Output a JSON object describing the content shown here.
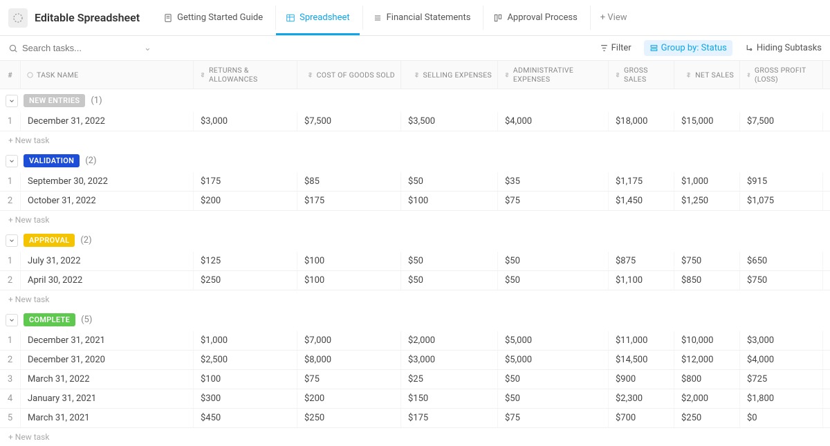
{
  "header": {
    "title": "Editable Spreadsheet",
    "tabs": [
      {
        "label": "Getting Started Guide"
      },
      {
        "label": "Spreadsheet",
        "active": true
      },
      {
        "label": "Financial Statements"
      },
      {
        "label": "Approval Process"
      }
    ],
    "add_view": "+ View"
  },
  "toolbar": {
    "search_placeholder": "Search tasks...",
    "filter": "Filter",
    "group_by": "Group by: Status",
    "hiding": "Hiding Subtasks"
  },
  "columns": {
    "index": "#",
    "task": "TASK NAME",
    "returns": "RETURNS & ALLOWANCES",
    "cogs": "COST OF GOODS SOLD",
    "selling": "SELLING EXPENSES",
    "admin": "ADMINISTRATIVE EXPENSES",
    "gross_sales": "GROSS SALES",
    "net_sales": "NET SALES",
    "gross_profit": "GROSS PROFIT (LOSS)"
  },
  "groups": [
    {
      "label": "NEW ENTRIES",
      "badge": "new",
      "count": "(1)",
      "rows": [
        {
          "idx": "1",
          "task": "December 31, 2022",
          "returns": "$3,000",
          "cogs": "$7,500",
          "selling": "$3,500",
          "admin": "$4,000",
          "gross_sales": "$18,000",
          "net_sales": "$15,000",
          "gross_profit": "$7,500"
        }
      ]
    },
    {
      "label": "VALIDATION",
      "badge": "validation",
      "count": "(2)",
      "rows": [
        {
          "idx": "1",
          "task": "September 30, 2022",
          "returns": "$175",
          "cogs": "$85",
          "selling": "$50",
          "admin": "$35",
          "gross_sales": "$1,175",
          "net_sales": "$1,000",
          "gross_profit": "$915"
        },
        {
          "idx": "2",
          "task": "October 31, 2022",
          "returns": "$200",
          "cogs": "$175",
          "selling": "$100",
          "admin": "$75",
          "gross_sales": "$1,450",
          "net_sales": "$1,250",
          "gross_profit": "$1,075"
        }
      ]
    },
    {
      "label": "APPROVAL",
      "badge": "approval",
      "count": "(2)",
      "rows": [
        {
          "idx": "1",
          "task": "July 31, 2022",
          "returns": "$125",
          "cogs": "$100",
          "selling": "$50",
          "admin": "$50",
          "gross_sales": "$875",
          "net_sales": "$750",
          "gross_profit": "$650"
        },
        {
          "idx": "2",
          "task": "April 30, 2022",
          "returns": "$250",
          "cogs": "$100",
          "selling": "$50",
          "admin": "$50",
          "gross_sales": "$1,100",
          "net_sales": "$850",
          "gross_profit": "$750"
        }
      ]
    },
    {
      "label": "COMPLETE",
      "badge": "complete",
      "count": "(5)",
      "rows": [
        {
          "idx": "1",
          "task": "December 31, 2021",
          "returns": "$1,000",
          "cogs": "$7,000",
          "selling": "$2,000",
          "admin": "$5,000",
          "gross_sales": "$11,000",
          "net_sales": "$10,000",
          "gross_profit": "$3,000"
        },
        {
          "idx": "2",
          "task": "December 31, 2020",
          "returns": "$2,500",
          "cogs": "$8,000",
          "selling": "$3,000",
          "admin": "$5,000",
          "gross_sales": "$14,500",
          "net_sales": "$12,000",
          "gross_profit": "$4,000"
        },
        {
          "idx": "3",
          "task": "March 31, 2022",
          "returns": "$100",
          "cogs": "$75",
          "selling": "$25",
          "admin": "$50",
          "gross_sales": "$900",
          "net_sales": "$800",
          "gross_profit": "$725"
        },
        {
          "idx": "4",
          "task": "January 31, 2021",
          "returns": "$300",
          "cogs": "$200",
          "selling": "$150",
          "admin": "$50",
          "gross_sales": "$2,300",
          "net_sales": "$2,000",
          "gross_profit": "$1,800"
        },
        {
          "idx": "5",
          "task": "March 31, 2021",
          "returns": "$450",
          "cogs": "$250",
          "selling": "$175",
          "admin": "$75",
          "gross_sales": "$700",
          "net_sales": "$250",
          "gross_profit": "$0"
        }
      ]
    }
  ],
  "new_task_label": "+ New task"
}
